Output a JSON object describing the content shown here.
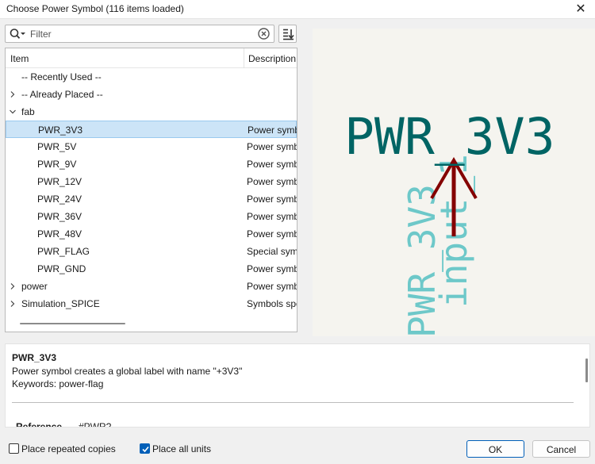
{
  "window": {
    "title": "Choose Power Symbol (116 items loaded)",
    "close_glyph": "✕"
  },
  "filter": {
    "placeholder": "Filter",
    "value": ""
  },
  "sort_button": {
    "icon": "sort-icon"
  },
  "tree": {
    "columns": {
      "item": "Item",
      "description": "Description"
    },
    "rows": [
      {
        "name": "-- Recently Used --",
        "description": "",
        "expander": "none",
        "level": 0,
        "selected": false
      },
      {
        "name": "-- Already Placed --",
        "description": "",
        "expander": "collapsed",
        "level": 0,
        "selected": false
      },
      {
        "name": "fab",
        "description": "",
        "expander": "expanded",
        "level": 0,
        "selected": false
      },
      {
        "name": "PWR_3V3",
        "description": "Power symb",
        "expander": "none",
        "level": 1,
        "selected": true
      },
      {
        "name": "PWR_5V",
        "description": "Power symb",
        "expander": "none",
        "level": 1,
        "selected": false
      },
      {
        "name": "PWR_9V",
        "description": "Power symb",
        "expander": "none",
        "level": 1,
        "selected": false
      },
      {
        "name": "PWR_12V",
        "description": "Power symb",
        "expander": "none",
        "level": 1,
        "selected": false
      },
      {
        "name": "PWR_24V",
        "description": "Power symb",
        "expander": "none",
        "level": 1,
        "selected": false
      },
      {
        "name": "PWR_36V",
        "description": "Power symb",
        "expander": "none",
        "level": 1,
        "selected": false
      },
      {
        "name": "PWR_48V",
        "description": "Power symb",
        "expander": "none",
        "level": 1,
        "selected": false
      },
      {
        "name": "PWR_FLAG",
        "description": "Special sym",
        "expander": "none",
        "level": 1,
        "selected": false
      },
      {
        "name": "PWR_GND",
        "description": "Power symb",
        "expander": "none",
        "level": 1,
        "selected": false
      },
      {
        "name": "power",
        "description": "Power symb",
        "expander": "collapsed",
        "level": 0,
        "selected": false
      },
      {
        "name": "Simulation_SPICE",
        "description": "Symbols spe",
        "expander": "collapsed",
        "level": 0,
        "selected": false
      }
    ]
  },
  "preview": {
    "value_text": "PWR_3V3",
    "pin_name_text": "PWR_3V3",
    "pin_label_text": "input_1",
    "colors": {
      "value": "#006464",
      "pin_text": "#6dc8c9",
      "pin": "#840000",
      "background": "#f5f4ef"
    }
  },
  "details": {
    "title": "PWR_3V3",
    "description": "Power symbol creates a global label with name \"+3V3\"",
    "keywords": "Keywords: power-flag",
    "reference_label": "Reference",
    "reference_value": "#PWR?"
  },
  "footer": {
    "place_repeated_label": "Place repeated copies",
    "place_repeated_checked": false,
    "place_all_units_label": "Place all units",
    "place_all_units_checked": true,
    "ok_label": "OK",
    "cancel_label": "Cancel"
  },
  "colors": {
    "accent": "#005fb8",
    "selection": "#cce4f7",
    "selection_border": "#99c9ef"
  }
}
